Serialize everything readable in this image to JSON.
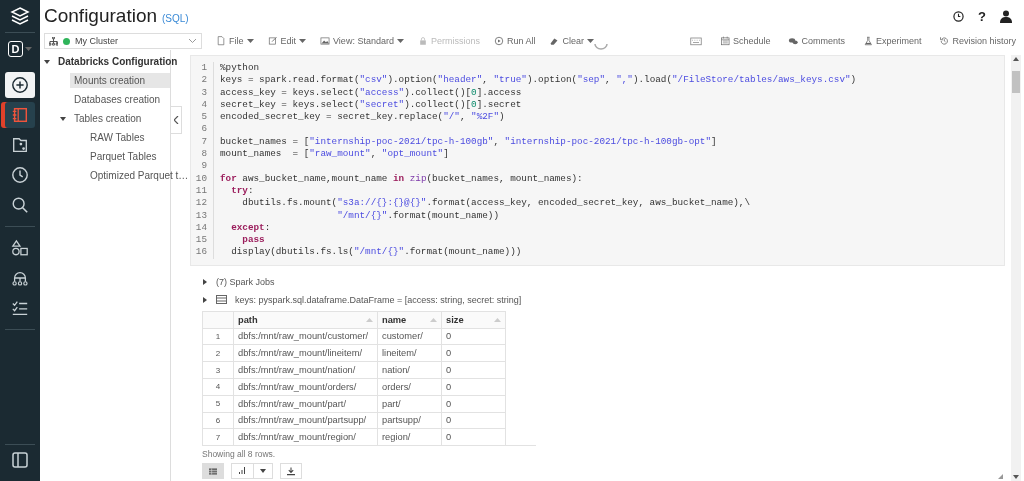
{
  "nav_rail": {
    "workspace_initial": "D",
    "items": [
      {
        "kind": "create",
        "selected": false
      },
      {
        "kind": "notebook",
        "selected": true
      },
      {
        "kind": "repos",
        "selected": false
      },
      {
        "kind": "recents",
        "selected": false
      },
      {
        "kind": "search",
        "selected": false
      },
      {
        "kind": "data",
        "selected": false
      },
      {
        "kind": "compute",
        "selected": false
      },
      {
        "kind": "jobs",
        "selected": false
      }
    ]
  },
  "header": {
    "title": "Configuration",
    "language": "(SQL)",
    "help_label": "?"
  },
  "toolbar": {
    "cluster": {
      "name": "My Cluster",
      "running": true
    },
    "menus": [
      {
        "kind": "file",
        "label": "File",
        "dropdown": true,
        "disabled": false
      },
      {
        "kind": "edit",
        "label": "Edit",
        "dropdown": true,
        "disabled": false
      },
      {
        "kind": "view",
        "label": "View: Standard",
        "dropdown": true,
        "disabled": false
      },
      {
        "kind": "lock",
        "label": "Permissions",
        "dropdown": false,
        "disabled": true
      },
      {
        "kind": "run",
        "label": "Run All",
        "dropdown": false,
        "disabled": false
      },
      {
        "kind": "clear",
        "label": "Clear",
        "dropdown": true,
        "disabled": false
      }
    ],
    "right_actions": [
      {
        "kind": "keyboard"
      },
      {
        "kind": "calendar",
        "label": "Schedule"
      },
      {
        "kind": "comments",
        "label": "Comments"
      },
      {
        "kind": "flask",
        "label": "Experiment"
      },
      {
        "kind": "history",
        "label": "Revision history"
      }
    ]
  },
  "sidebar": {
    "items": [
      {
        "label": "Databricks Configuration",
        "expanded": true,
        "selected": false,
        "children": [
          {
            "label": "Mounts creation",
            "selected": true
          },
          {
            "label": "Databases creation",
            "selected": false
          },
          {
            "label": "Tables creation",
            "expanded": true,
            "selected": false,
            "children": [
              {
                "label": "RAW Tables",
                "selected": false
              },
              {
                "label": "Parquet Tables",
                "selected": false
              },
              {
                "label": "Optimized Parquet t…",
                "selected": false
              }
            ]
          }
        ]
      }
    ]
  },
  "cell": {
    "code_lines": [
      {
        "number": "1",
        "tokens": [
          {
            "kind": "plain",
            "text": "%python"
          }
        ]
      },
      {
        "number": "2",
        "tokens": [
          {
            "kind": "plain",
            "text": "keys = spark.read.format("
          },
          {
            "kind": "string",
            "text": "\"csv\""
          },
          {
            "kind": "plain",
            "text": ").option("
          },
          {
            "kind": "string",
            "text": "\"header\""
          },
          {
            "kind": "plain",
            "text": ", "
          },
          {
            "kind": "string",
            "text": "\"true\""
          },
          {
            "kind": "plain",
            "text": ").option("
          },
          {
            "kind": "string",
            "text": "\"sep\""
          },
          {
            "kind": "plain",
            "text": ", "
          },
          {
            "kind": "string",
            "text": "\",\""
          },
          {
            "kind": "plain",
            "text": ").load("
          },
          {
            "kind": "string",
            "text": "\"/FileStore/tables/aws_keys.csv\""
          },
          {
            "kind": "plain",
            "text": ")"
          }
        ]
      },
      {
        "number": "3",
        "tokens": [
          {
            "kind": "plain",
            "text": "access_key = keys.select("
          },
          {
            "kind": "string",
            "text": "\"access\""
          },
          {
            "kind": "plain",
            "text": ").collect()["
          },
          {
            "kind": "number",
            "text": "0"
          },
          {
            "kind": "plain",
            "text": "].access"
          }
        ]
      },
      {
        "number": "4",
        "tokens": [
          {
            "kind": "plain",
            "text": "secret_key = keys.select("
          },
          {
            "kind": "string",
            "text": "\"secret\""
          },
          {
            "kind": "plain",
            "text": ").collect()["
          },
          {
            "kind": "number",
            "text": "0"
          },
          {
            "kind": "plain",
            "text": "].secret"
          }
        ]
      },
      {
        "number": "5",
        "tokens": [
          {
            "kind": "plain",
            "text": "encoded_secret_key = secret_key.replace("
          },
          {
            "kind": "string",
            "text": "\"/\""
          },
          {
            "kind": "plain",
            "text": ", "
          },
          {
            "kind": "string",
            "text": "\"%2F\""
          },
          {
            "kind": "plain",
            "text": ")"
          }
        ]
      },
      {
        "number": "6"
      },
      {
        "number": "7",
        "tokens": [
          {
            "kind": "plain",
            "text": "bucket_names = ["
          },
          {
            "kind": "string",
            "text": "\"internship-poc-2021/tpc-h-100gb\""
          },
          {
            "kind": "plain",
            "text": ", "
          },
          {
            "kind": "string",
            "text": "\"internship-poc-2021/tpc-h-100gb-opt\""
          },
          {
            "kind": "plain",
            "text": "]"
          }
        ]
      },
      {
        "number": "8",
        "tokens": [
          {
            "kind": "plain",
            "text": "mount_names  = ["
          },
          {
            "kind": "string",
            "text": "\"raw_mount\""
          },
          {
            "kind": "plain",
            "text": ", "
          },
          {
            "kind": "string",
            "text": "\"opt_mount\""
          },
          {
            "kind": "plain",
            "text": "]"
          }
        ]
      },
      {
        "number": "9"
      },
      {
        "number": "10",
        "tokens": [
          {
            "kind": "keyword",
            "text": "for"
          },
          {
            "kind": "plain",
            "text": " aws_bucket_name,mount_name "
          },
          {
            "kind": "keyword",
            "text": "in"
          },
          {
            "kind": "builtin",
            "text": " zip"
          },
          {
            "kind": "plain",
            "text": "(bucket_names, mount_names):"
          }
        ]
      },
      {
        "number": "11",
        "tokens": [
          {
            "kind": "keyword",
            "text": "  try"
          },
          {
            "kind": "plain",
            "text": ":"
          }
        ]
      },
      {
        "number": "12",
        "tokens": [
          {
            "kind": "plain",
            "text": "    dbutils.fs.mount("
          },
          {
            "kind": "string",
            "text": "\"s3a://{}:{}@{}\""
          },
          {
            "kind": "plain",
            "text": ".format(access_key, encoded_secret_key, aws_bucket_name),\\"
          }
        ]
      },
      {
        "number": "13",
        "tokens": [
          {
            "kind": "string",
            "text": "                     \"/mnt/{}\""
          },
          {
            "kind": "plain",
            "text": ".format(mount_name))"
          }
        ]
      },
      {
        "number": "14",
        "tokens": [
          {
            "kind": "keyword",
            "text": "  except"
          },
          {
            "kind": "plain",
            "text": ":"
          }
        ]
      },
      {
        "number": "15",
        "tokens": [
          {
            "kind": "keyword",
            "text": "    pass"
          }
        ]
      },
      {
        "number": "16",
        "tokens": [
          {
            "kind": "plain",
            "text": "  display(dbutils.fs.ls("
          },
          {
            "kind": "string",
            "text": "\"/mnt/{}\""
          },
          {
            "kind": "plain",
            "text": ".format(mount_name)))"
          }
        ]
      }
    ]
  },
  "output": {
    "spark_jobs": {
      "label": "(7) Spark Jobs",
      "expanded": false
    },
    "schema": {
      "label": "keys:  pyspark.sql.dataframe.DataFrame = [access: string, secret: string]",
      "expanded": false
    },
    "table": {
      "columns": [
        "path",
        "name",
        "size"
      ],
      "rows": [
        {
          "index": "1",
          "cells": [
            "dbfs:/mnt/raw_mount/customer/",
            "customer/",
            "0"
          ]
        },
        {
          "index": "2",
          "cells": [
            "dbfs:/mnt/raw_mount/lineitem/",
            "lineitem/",
            "0"
          ]
        },
        {
          "index": "3",
          "cells": [
            "dbfs:/mnt/raw_mount/nation/",
            "nation/",
            "0"
          ]
        },
        {
          "index": "4",
          "cells": [
            "dbfs:/mnt/raw_mount/orders/",
            "orders/",
            "0"
          ]
        },
        {
          "index": "5",
          "cells": [
            "dbfs:/mnt/raw_mount/part/",
            "part/",
            "0"
          ]
        },
        {
          "index": "6",
          "cells": [
            "dbfs:/mnt/raw_mount/partsupp/",
            "partsupp/",
            "0"
          ]
        },
        {
          "index": "7",
          "cells": [
            "dbfs:/mnt/raw_mount/region/",
            "region/",
            "0"
          ]
        }
      ]
    },
    "row_summary": "Showing all 8 rows.",
    "view_buttons": [
      {
        "kind": "table",
        "selected": true
      },
      {
        "kind": "chart",
        "selected": false
      }
    ]
  }
}
